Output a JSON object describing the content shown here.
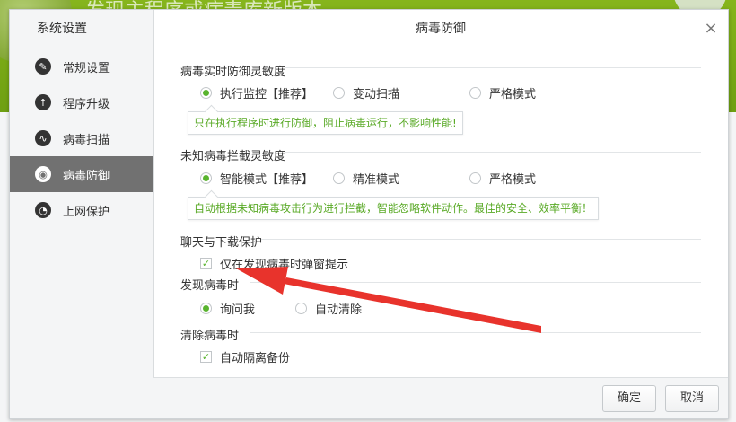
{
  "background": {
    "title": "发现主程序或病毒库新版本"
  },
  "sidebar": {
    "title": "系统设置",
    "items": [
      {
        "label": "常规设置",
        "icon": "wrench-icon",
        "glyph": "✎",
        "active": false
      },
      {
        "label": "程序升级",
        "icon": "upload-arrow-icon",
        "glyph": "↑",
        "active": false
      },
      {
        "label": "病毒扫描",
        "icon": "pulse-icon",
        "glyph": "∿",
        "active": false
      },
      {
        "label": "病毒防御",
        "icon": "eye-icon",
        "glyph": "◉",
        "active": true
      },
      {
        "label": "上网保护",
        "icon": "wifi-icon",
        "glyph": "◔",
        "active": false
      }
    ]
  },
  "main": {
    "title": "病毒防御",
    "close_glyph": "×",
    "realtime": {
      "title": "病毒实时防御灵敏度",
      "options": [
        "执行监控【推荐】",
        "变动扫描",
        "严格模式"
      ],
      "selected": 0,
      "tip": "只在执行程序时进行防御，阻止病毒运行，不影响性能!"
    },
    "unknown": {
      "title": "未知病毒拦截灵敏度",
      "options": [
        "智能模式【推荐】",
        "精准模式",
        "严格模式"
      ],
      "selected": 0,
      "tip": "自动根据未知病毒攻击行为进行拦截，智能忽略软件动作。最佳的安全、效率平衡！"
    },
    "chat": {
      "title": "聊天与下载保护",
      "checkbox": "仅在发现病毒时弹窗提示",
      "checked": true
    },
    "found": {
      "title": "发现病毒时",
      "options": [
        "询问我",
        "自动清除"
      ],
      "selected": 0
    },
    "clean": {
      "title": "清除病毒时",
      "checkbox": "自动隔离备份",
      "checked": true
    }
  },
  "footer": {
    "ok": "确定",
    "cancel": "取消"
  },
  "colors": {
    "accent_green": "#59b42e",
    "tip_text": "#5aaa27",
    "arrow": "#e8332c",
    "active_nav": "#717171"
  }
}
